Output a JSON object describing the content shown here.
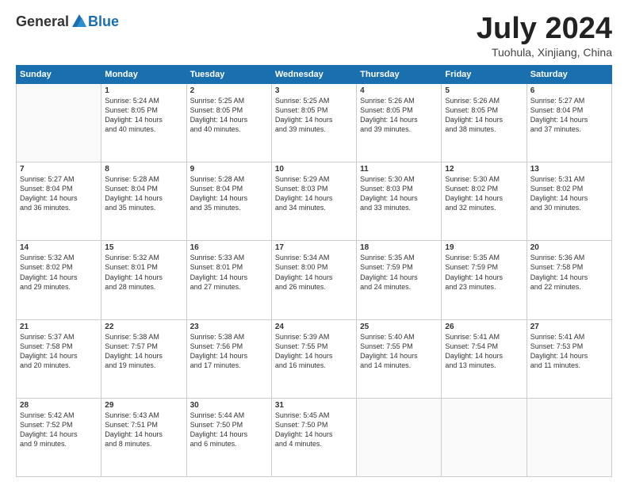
{
  "logo": {
    "general": "General",
    "blue": "Blue"
  },
  "header": {
    "month": "July 2024",
    "location": "Tuohula, Xinjiang, China"
  },
  "weekdays": [
    "Sunday",
    "Monday",
    "Tuesday",
    "Wednesday",
    "Thursday",
    "Friday",
    "Saturday"
  ],
  "weeks": [
    [
      {
        "day": "",
        "content": ""
      },
      {
        "day": "1",
        "content": "Sunrise: 5:24 AM\nSunset: 8:05 PM\nDaylight: 14 hours\nand 40 minutes."
      },
      {
        "day": "2",
        "content": "Sunrise: 5:25 AM\nSunset: 8:05 PM\nDaylight: 14 hours\nand 40 minutes."
      },
      {
        "day": "3",
        "content": "Sunrise: 5:25 AM\nSunset: 8:05 PM\nDaylight: 14 hours\nand 39 minutes."
      },
      {
        "day": "4",
        "content": "Sunrise: 5:26 AM\nSunset: 8:05 PM\nDaylight: 14 hours\nand 39 minutes."
      },
      {
        "day": "5",
        "content": "Sunrise: 5:26 AM\nSunset: 8:05 PM\nDaylight: 14 hours\nand 38 minutes."
      },
      {
        "day": "6",
        "content": "Sunrise: 5:27 AM\nSunset: 8:04 PM\nDaylight: 14 hours\nand 37 minutes."
      }
    ],
    [
      {
        "day": "7",
        "content": "Sunrise: 5:27 AM\nSunset: 8:04 PM\nDaylight: 14 hours\nand 36 minutes."
      },
      {
        "day": "8",
        "content": "Sunrise: 5:28 AM\nSunset: 8:04 PM\nDaylight: 14 hours\nand 35 minutes."
      },
      {
        "day": "9",
        "content": "Sunrise: 5:28 AM\nSunset: 8:04 PM\nDaylight: 14 hours\nand 35 minutes."
      },
      {
        "day": "10",
        "content": "Sunrise: 5:29 AM\nSunset: 8:03 PM\nDaylight: 14 hours\nand 34 minutes."
      },
      {
        "day": "11",
        "content": "Sunrise: 5:30 AM\nSunset: 8:03 PM\nDaylight: 14 hours\nand 33 minutes."
      },
      {
        "day": "12",
        "content": "Sunrise: 5:30 AM\nSunset: 8:02 PM\nDaylight: 14 hours\nand 32 minutes."
      },
      {
        "day": "13",
        "content": "Sunrise: 5:31 AM\nSunset: 8:02 PM\nDaylight: 14 hours\nand 30 minutes."
      }
    ],
    [
      {
        "day": "14",
        "content": "Sunrise: 5:32 AM\nSunset: 8:02 PM\nDaylight: 14 hours\nand 29 minutes."
      },
      {
        "day": "15",
        "content": "Sunrise: 5:32 AM\nSunset: 8:01 PM\nDaylight: 14 hours\nand 28 minutes."
      },
      {
        "day": "16",
        "content": "Sunrise: 5:33 AM\nSunset: 8:01 PM\nDaylight: 14 hours\nand 27 minutes."
      },
      {
        "day": "17",
        "content": "Sunrise: 5:34 AM\nSunset: 8:00 PM\nDaylight: 14 hours\nand 26 minutes."
      },
      {
        "day": "18",
        "content": "Sunrise: 5:35 AM\nSunset: 7:59 PM\nDaylight: 14 hours\nand 24 minutes."
      },
      {
        "day": "19",
        "content": "Sunrise: 5:35 AM\nSunset: 7:59 PM\nDaylight: 14 hours\nand 23 minutes."
      },
      {
        "day": "20",
        "content": "Sunrise: 5:36 AM\nSunset: 7:58 PM\nDaylight: 14 hours\nand 22 minutes."
      }
    ],
    [
      {
        "day": "21",
        "content": "Sunrise: 5:37 AM\nSunset: 7:58 PM\nDaylight: 14 hours\nand 20 minutes."
      },
      {
        "day": "22",
        "content": "Sunrise: 5:38 AM\nSunset: 7:57 PM\nDaylight: 14 hours\nand 19 minutes."
      },
      {
        "day": "23",
        "content": "Sunrise: 5:38 AM\nSunset: 7:56 PM\nDaylight: 14 hours\nand 17 minutes."
      },
      {
        "day": "24",
        "content": "Sunrise: 5:39 AM\nSunset: 7:55 PM\nDaylight: 14 hours\nand 16 minutes."
      },
      {
        "day": "25",
        "content": "Sunrise: 5:40 AM\nSunset: 7:55 PM\nDaylight: 14 hours\nand 14 minutes."
      },
      {
        "day": "26",
        "content": "Sunrise: 5:41 AM\nSunset: 7:54 PM\nDaylight: 14 hours\nand 13 minutes."
      },
      {
        "day": "27",
        "content": "Sunrise: 5:41 AM\nSunset: 7:53 PM\nDaylight: 14 hours\nand 11 minutes."
      }
    ],
    [
      {
        "day": "28",
        "content": "Sunrise: 5:42 AM\nSunset: 7:52 PM\nDaylight: 14 hours\nand 9 minutes."
      },
      {
        "day": "29",
        "content": "Sunrise: 5:43 AM\nSunset: 7:51 PM\nDaylight: 14 hours\nand 8 minutes."
      },
      {
        "day": "30",
        "content": "Sunrise: 5:44 AM\nSunset: 7:50 PM\nDaylight: 14 hours\nand 6 minutes."
      },
      {
        "day": "31",
        "content": "Sunrise: 5:45 AM\nSunset: 7:50 PM\nDaylight: 14 hours\nand 4 minutes."
      },
      {
        "day": "",
        "content": ""
      },
      {
        "day": "",
        "content": ""
      },
      {
        "day": "",
        "content": ""
      }
    ]
  ]
}
